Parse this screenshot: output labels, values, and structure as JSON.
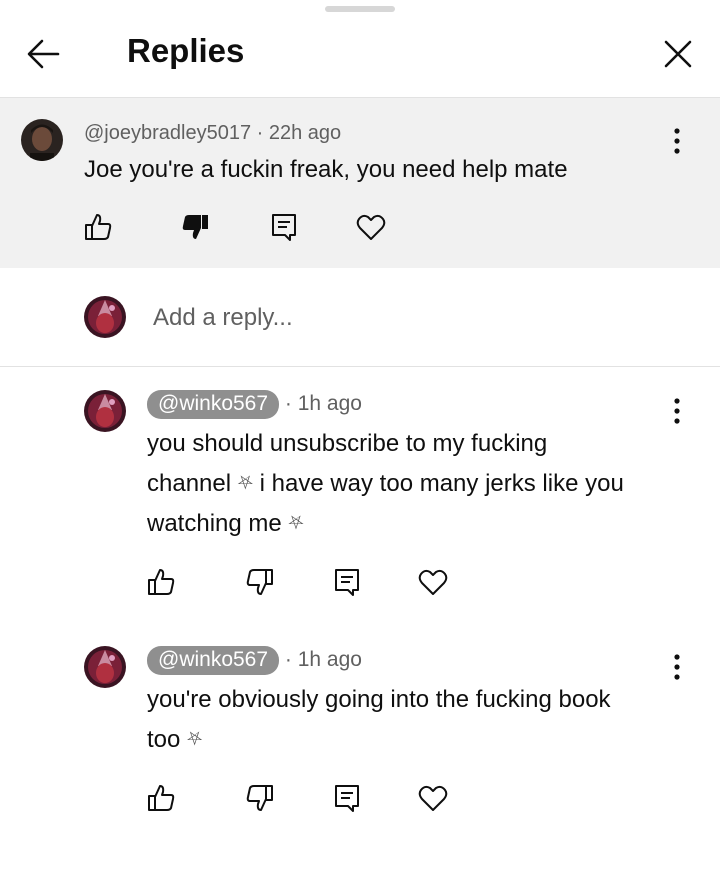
{
  "header": {
    "title": "Replies",
    "back_icon": "arrow-left-icon",
    "close_icon": "close-icon"
  },
  "parent_comment": {
    "author": "@joeybradley5017",
    "time": "22h ago",
    "separator": " · ",
    "text": "Joe you're a fuckin freak, you need help mate",
    "disliked": true
  },
  "add_reply": {
    "placeholder": "Add a reply..."
  },
  "replies": [
    {
      "author": "@winko567",
      "time": "1h ago",
      "separator": " · ",
      "lines": [
        "you should unsubscribe to my fucking",
        "channel",
        "i have way too many jerks like you",
        "watching me"
      ],
      "symbol": "⛧"
    },
    {
      "author": "@winko567",
      "time": "1h ago",
      "separator": " · ",
      "lines": [
        "you're obviously going into the fucking book",
        "too"
      ],
      "symbol": "⛧"
    }
  ],
  "colors": {
    "parent_bg": "#f1f1f1",
    "chip_bg": "#8f8f8f",
    "meta": "#606060",
    "text": "#0f0f0f"
  }
}
